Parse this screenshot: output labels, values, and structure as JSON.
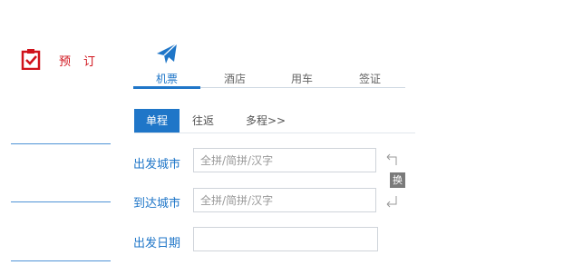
{
  "booking": {
    "label": "预订"
  },
  "top_tabs": [
    {
      "label": "机票"
    },
    {
      "label": "酒店"
    },
    {
      "label": "用车"
    },
    {
      "label": "签证"
    }
  ],
  "trip_types": [
    {
      "label": "单程"
    },
    {
      "label": "往返"
    },
    {
      "label": "多程>>"
    }
  ],
  "form": {
    "from_label": "出发城市",
    "from_placeholder": "全拼/简拼/汉字",
    "to_label": "到达城市",
    "to_placeholder": "全拼/简拼/汉字",
    "date_label": "出发日期",
    "date_value": ""
  },
  "swap": {
    "label": "换"
  },
  "colors": {
    "accent": "#1f76c8",
    "booking_red": "#d0121b"
  },
  "icons": {
    "booking": "clipboard-check-icon",
    "plane": "airplane-icon",
    "swap": "swap-arrows-icon"
  }
}
